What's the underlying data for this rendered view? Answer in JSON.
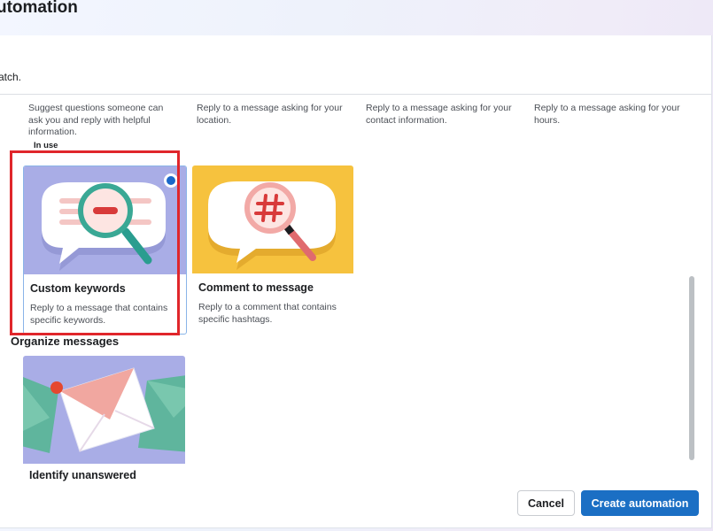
{
  "header": {
    "title": "utomation"
  },
  "panel": {
    "subtitle": "atch.",
    "top_cards": [
      {
        "desc": "Suggest questions someone can ask you and reply with helpful information."
      },
      {
        "desc": "Reply to a message asking for your location."
      },
      {
        "desc": "Reply to a message asking for your contact information."
      },
      {
        "desc": "Reply to a message asking for your hours."
      }
    ],
    "in_use_label": "In use",
    "cards": [
      {
        "title": "Custom keywords",
        "desc": "Reply to a message that contains specific keywords.",
        "art_bg": "#a9ade6",
        "selected": true
      },
      {
        "title": "Comment to message",
        "desc": "Reply to a comment that contains specific hashtags.",
        "art_bg": "#f6c23e"
      }
    ],
    "section_title": "Organize messages",
    "organize_cards": [
      {
        "title": "Identify unanswered",
        "art_bg": "#a9ade6"
      }
    ]
  },
  "footer": {
    "cancel_label": "Cancel",
    "create_label": "Create automation"
  },
  "colors": {
    "accent": "#1b6fc4",
    "highlight": "#e0262b",
    "selected_radio": "#1a68c9"
  }
}
